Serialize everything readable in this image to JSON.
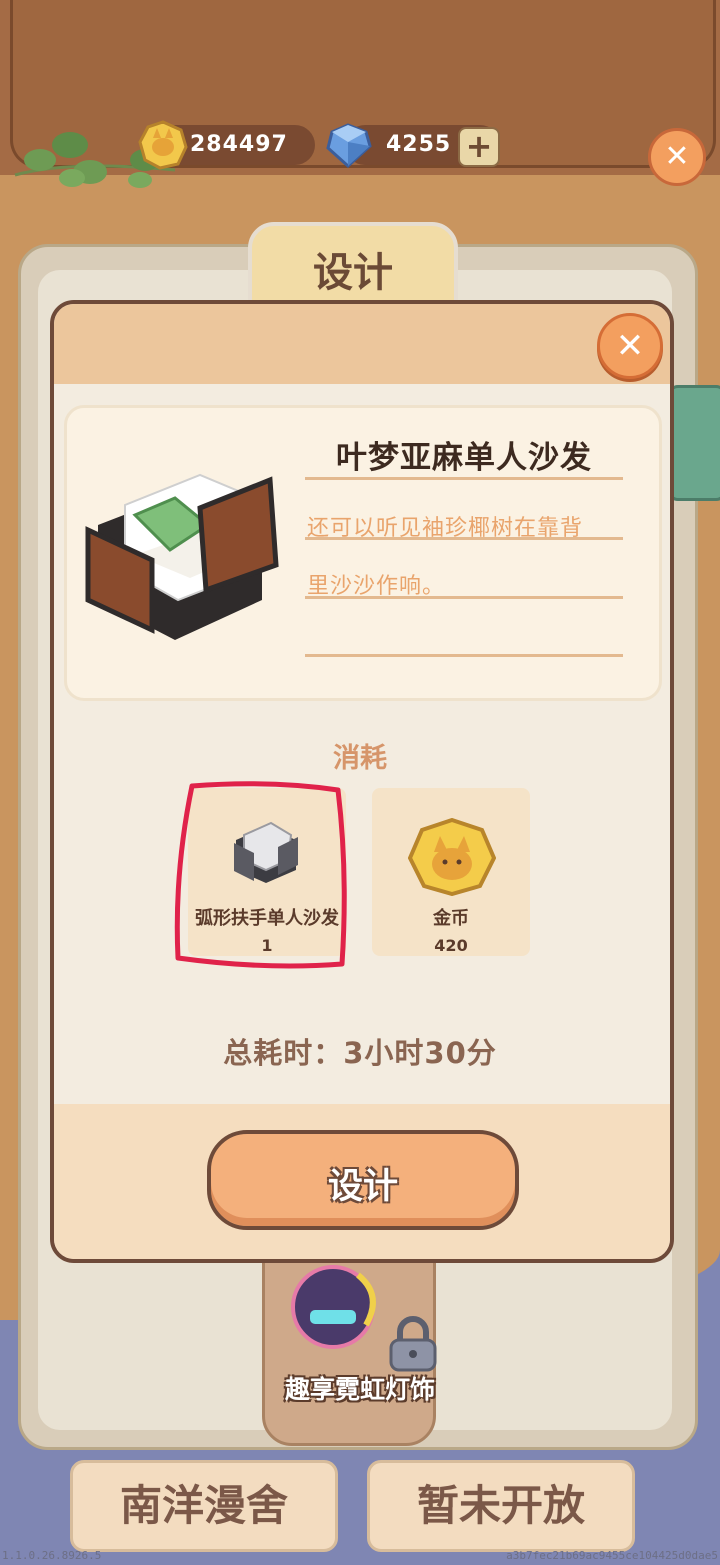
{
  "currency": {
    "gold_amount": "284497",
    "diamond_amount": "4255",
    "add_symbol": "+"
  },
  "header": {
    "tab_label": "设计",
    "close_symbol": "✕"
  },
  "dialog": {
    "close_symbol": "✕",
    "item_name": "叶梦亚麻单人沙发",
    "description_line1": "还可以听见袖珍椰树在靠背",
    "description_line2": "里沙沙作响。",
    "cost_label": "消耗",
    "costs": [
      {
        "name": "弧形扶手单人沙发",
        "amount": "1"
      },
      {
        "name": "金币",
        "amount": "420"
      }
    ],
    "total_time": "总耗时：3小时30分",
    "design_button": "设计"
  },
  "background": {
    "neon_label": "趣享霓虹灯饰",
    "bottom_tabs": [
      "南洋漫舍",
      "暂未开放"
    ]
  },
  "footer": {
    "version": "1.1.0.26.8926.5",
    "build_id": "a3b7fec21b69ac9455ce104425d0dae5"
  },
  "colors": {
    "accent": "#f4b07c",
    "frame": "#6e4a39",
    "highlight": "#e0224a"
  }
}
